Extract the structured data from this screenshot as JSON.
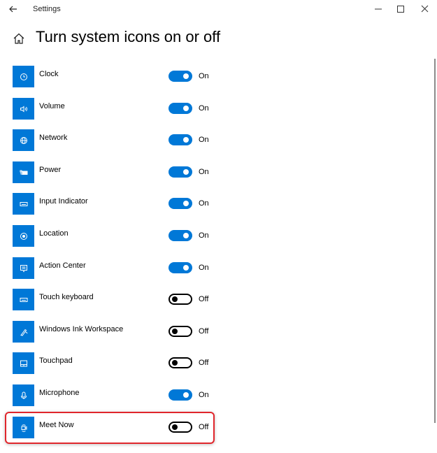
{
  "window": {
    "app_title": "Settings",
    "back_icon": "back-arrow-icon",
    "controls": [
      "minimize",
      "maximize",
      "close"
    ]
  },
  "header": {
    "home_icon": "home-icon",
    "title": "Turn system icons on or off"
  },
  "colors": {
    "accent": "#0078d7",
    "highlight": "#e0262c"
  },
  "items": [
    {
      "label": "Clock",
      "icon": "clock-icon",
      "on": true,
      "state": "On"
    },
    {
      "label": "Volume",
      "icon": "volume-icon",
      "on": true,
      "state": "On"
    },
    {
      "label": "Network",
      "icon": "network-globe-icon",
      "on": true,
      "state": "On"
    },
    {
      "label": "Power",
      "icon": "power-battery-icon",
      "on": true,
      "state": "On"
    },
    {
      "label": "Input Indicator",
      "icon": "keyboard-icon",
      "on": true,
      "state": "On"
    },
    {
      "label": "Location",
      "icon": "location-icon",
      "on": true,
      "state": "On"
    },
    {
      "label": "Action Center",
      "icon": "action-center-icon",
      "on": true,
      "state": "On"
    },
    {
      "label": "Touch keyboard",
      "icon": "touch-keyboard-icon",
      "on": false,
      "state": "Off"
    },
    {
      "label": "Windows Ink Workspace",
      "icon": "pen-ink-icon",
      "on": false,
      "state": "Off"
    },
    {
      "label": "Touchpad",
      "icon": "touchpad-icon",
      "on": false,
      "state": "Off"
    },
    {
      "label": "Microphone",
      "icon": "microphone-icon",
      "on": true,
      "state": "On"
    },
    {
      "label": "Meet Now",
      "icon": "meet-now-icon",
      "on": false,
      "state": "Off",
      "highlighted": true
    }
  ]
}
